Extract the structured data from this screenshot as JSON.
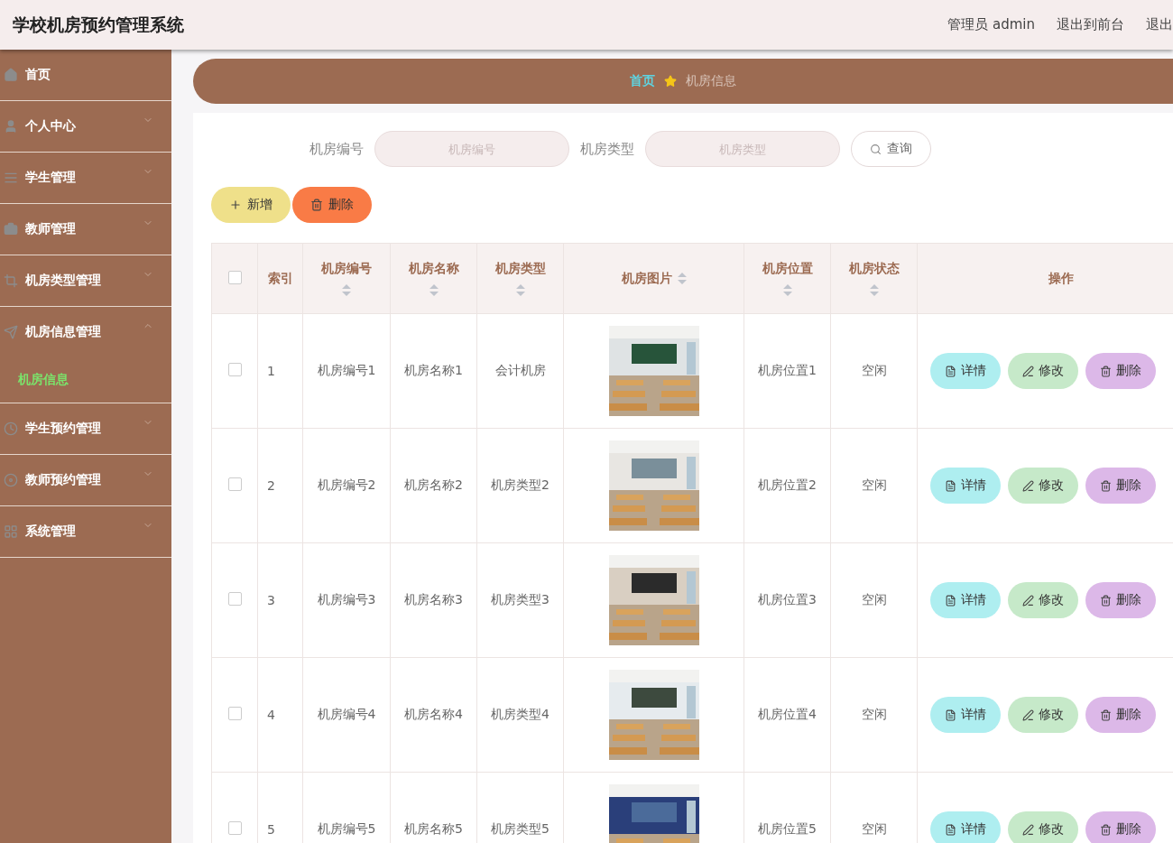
{
  "header": {
    "title": "学校机房预约管理系统",
    "user": "管理员 admin",
    "links": [
      "退出到前台",
      "退出"
    ]
  },
  "sidebar": {
    "items": [
      {
        "label": "首页",
        "kind": "link"
      },
      {
        "label": "个人中心",
        "kind": "menu",
        "expanded": false
      },
      {
        "label": "学生管理",
        "kind": "menu",
        "expanded": false
      },
      {
        "label": "教师管理",
        "kind": "menu",
        "expanded": false
      },
      {
        "label": "机房类型管理",
        "kind": "menu",
        "expanded": false
      },
      {
        "label": "机房信息管理",
        "kind": "menu",
        "expanded": true,
        "children": [
          {
            "label": "机房信息",
            "selected": true
          }
        ]
      },
      {
        "label": "学生预约管理",
        "kind": "menu",
        "expanded": false
      },
      {
        "label": "教师预约管理",
        "kind": "menu",
        "expanded": false
      },
      {
        "label": "系统管理",
        "kind": "menu",
        "expanded": false
      }
    ]
  },
  "breadcrumb": [
    {
      "label": "首页",
      "kind": "link"
    },
    {
      "label": "机房信息",
      "kind": "current"
    }
  ],
  "search": {
    "fields": [
      {
        "label": "机房编号",
        "placeholder": "机房编号"
      },
      {
        "label": "机房类型",
        "placeholder": "机房类型"
      }
    ],
    "button": "查询"
  },
  "actions": [
    {
      "label": "新增",
      "kind": "add"
    },
    {
      "label": "删除",
      "kind": "delete"
    }
  ],
  "table": {
    "select_all": {
      "checked": false
    },
    "columns": [
      {
        "label": "索引",
        "sortable": false
      },
      {
        "label": "机房编号",
        "sortable": true
      },
      {
        "label": "机房名称",
        "sortable": true
      },
      {
        "label": "机房类型",
        "sortable": true
      },
      {
        "label": "机房图片",
        "sortable": true
      },
      {
        "label": "机房位置",
        "sortable": true
      },
      {
        "label": "机房状态",
        "sortable": true
      },
      {
        "label": "操作",
        "sortable": false
      }
    ],
    "rows": [
      {
        "checked": false,
        "cells": [
          "1",
          "机房编号1",
          "机房名称1",
          "会计机房",
          {
            "kind": "picture"
          },
          "机房位置1",
          "空闲"
        ],
        "actions": [
          {
            "label": "详情",
            "kind": "detail"
          },
          {
            "label": "修改",
            "kind": "edit"
          },
          {
            "label": "删除",
            "kind": "delete"
          }
        ]
      },
      {
        "checked": false,
        "cells": [
          "2",
          "机房编号2",
          "机房名称2",
          "机房类型2",
          {
            "kind": "picture"
          },
          "机房位置2",
          "空闲"
        ],
        "actions": [
          {
            "label": "详情",
            "kind": "detail"
          },
          {
            "label": "修改",
            "kind": "edit"
          },
          {
            "label": "删除",
            "kind": "delete"
          }
        ]
      },
      {
        "checked": false,
        "cells": [
          "3",
          "机房编号3",
          "机房名称3",
          "机房类型3",
          {
            "kind": "picture"
          },
          "机房位置3",
          "空闲"
        ],
        "actions": [
          {
            "label": "详情",
            "kind": "detail"
          },
          {
            "label": "修改",
            "kind": "edit"
          },
          {
            "label": "删除",
            "kind": "delete"
          }
        ]
      },
      {
        "checked": false,
        "cells": [
          "4",
          "机房编号4",
          "机房名称4",
          "机房类型4",
          {
            "kind": "picture"
          },
          "机房位置4",
          "空闲"
        ],
        "actions": [
          {
            "label": "详情",
            "kind": "detail"
          },
          {
            "label": "修改",
            "kind": "edit"
          },
          {
            "label": "删除",
            "kind": "delete"
          }
        ]
      },
      {
        "checked": false,
        "cells": [
          "5",
          "机房编号5",
          "机房名称5",
          "机房类型5",
          {
            "kind": "picture"
          },
          "机房位置5",
          "空闲"
        ],
        "actions": [
          {
            "label": "详情",
            "kind": "detail"
          },
          {
            "label": "修改",
            "kind": "edit"
          },
          {
            "label": "删除",
            "kind": "delete"
          }
        ]
      }
    ]
  }
}
